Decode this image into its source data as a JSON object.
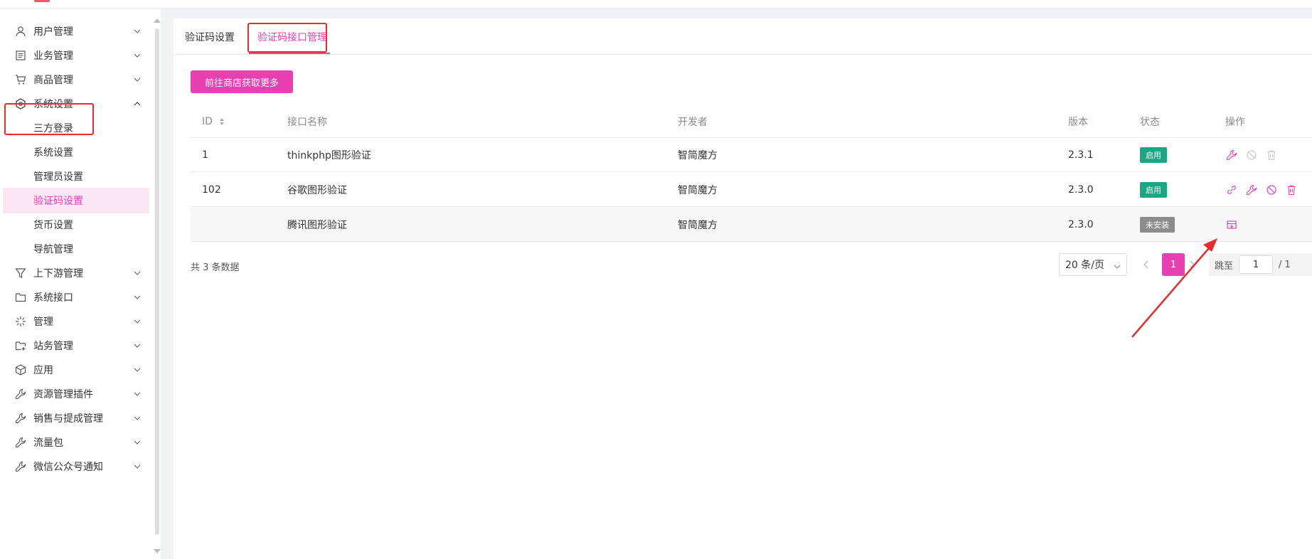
{
  "app": {
    "logo_text": "———"
  },
  "colors": {
    "accent": "#e83fb3",
    "enabled": "#1ba784",
    "not_installed": "#8c8c8c",
    "annotation_red": "#e82c2c"
  },
  "sidebar": {
    "items": [
      {
        "label": "用户管理",
        "icon": "user-icon",
        "expanded": false
      },
      {
        "label": "业务管理",
        "icon": "list-icon",
        "expanded": false
      },
      {
        "label": "商品管理",
        "icon": "cart-icon",
        "expanded": false
      },
      {
        "label": "系统设置",
        "icon": "settings-hexagon-icon",
        "expanded": true
      },
      {
        "label": "上下游管理",
        "icon": "funnel-icon",
        "expanded": false
      },
      {
        "label": "系统接口",
        "icon": "folder-icon",
        "expanded": false
      },
      {
        "label": "管理",
        "icon": "spark-icon",
        "expanded": false
      },
      {
        "label": "站务管理",
        "icon": "folder-add-icon",
        "expanded": false
      },
      {
        "label": "应用",
        "icon": "cube-icon",
        "expanded": false
      },
      {
        "label": "资源管理插件",
        "icon": "wrench-icon",
        "expanded": false
      },
      {
        "label": "销售与提成管理",
        "icon": "wrench-icon",
        "expanded": false
      },
      {
        "label": "流量包",
        "icon": "wrench-icon",
        "expanded": false
      },
      {
        "label": "微信公众号通知",
        "icon": "wrench-icon",
        "expanded": false
      }
    ],
    "sub_items": [
      {
        "label": "三方登录"
      },
      {
        "label": "系统设置"
      },
      {
        "label": "管理员设置"
      },
      {
        "label": "验证码设置",
        "active": true
      },
      {
        "label": "货币设置"
      },
      {
        "label": "导航管理"
      }
    ]
  },
  "tabs": [
    {
      "label": "验证码设置",
      "active": false
    },
    {
      "label": "验证码接口管理",
      "active": true
    }
  ],
  "toolbar": {
    "store_button": "前往商店获取更多"
  },
  "table": {
    "columns": [
      "ID",
      "接口名称",
      "开发者",
      "版本",
      "状态",
      "操作"
    ],
    "rows": [
      {
        "id": "1",
        "name": "thinkphp图形验证",
        "developer": "智简魔方",
        "version": "2.3.1",
        "status": "启用",
        "status_type": "enabled",
        "actions": [
          "wrench-icon",
          "disable-icon",
          "delete-icon"
        ]
      },
      {
        "id": "102",
        "name": "谷歌图形验证",
        "developer": "智简魔方",
        "version": "2.3.0",
        "status": "启用",
        "status_type": "enabled",
        "actions": [
          "link-icon",
          "wrench-icon",
          "disable-icon",
          "delete-icon"
        ]
      },
      {
        "id": "",
        "name": "腾讯图形验证",
        "developer": "智简魔方",
        "version": "2.3.0",
        "status": "未安装",
        "status_type": "not_installed",
        "actions": [
          "install-icon"
        ]
      }
    ]
  },
  "pagination": {
    "total_text": "共 3 条数据",
    "page_size": "20 条/页",
    "current_page": "1",
    "jump_label": "跳至",
    "jump_value": "1",
    "total_pages": "/ 1"
  }
}
